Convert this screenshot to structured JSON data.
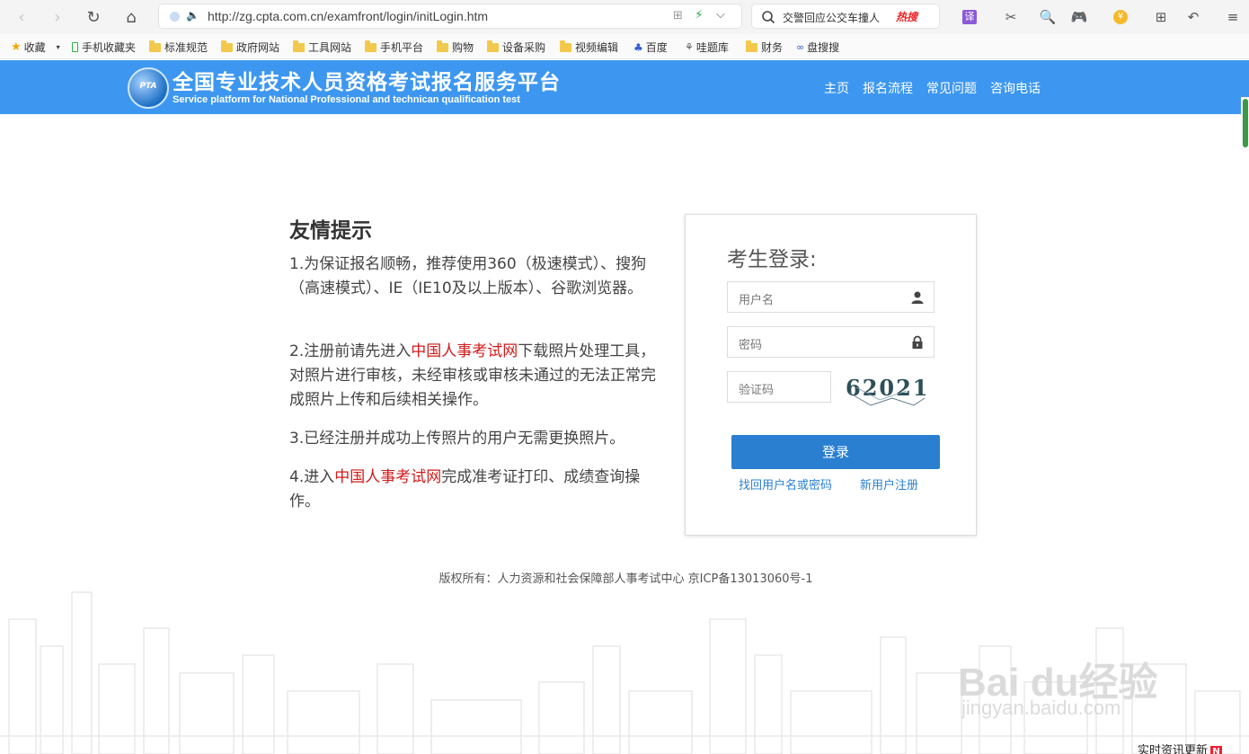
{
  "browser": {
    "url": "http://zg.cpta.com.cn/examfront/login/initLogin.htm",
    "search_text": "交警回应公交车撞人",
    "search_hot": "热搜"
  },
  "bookmarks": [
    "收藏",
    "手机收藏夹",
    "标准规范",
    "政府网站",
    "工具网站",
    "手机平台",
    "购物",
    "设备采购",
    "视频编辑",
    "百度",
    "哇题库",
    "财务",
    "盘搜搜"
  ],
  "site": {
    "logo_text": "PTA",
    "title": "全国专业技术人员资格考试报名服务平台",
    "subtitle": "Service platform for National Professional and technican qualification test",
    "nav": [
      "主页",
      "报名流程",
      "常见问题",
      "咨询电话"
    ]
  },
  "tips": {
    "title": "友情提示",
    "items": [
      {
        "text": "1.为保证报名顺畅，推荐使用360（极速模式）、搜狗（高速模式）、IE（IE10及以上版本）、谷歌浏览器。"
      },
      {
        "pre": "2.注册前请先进入",
        "link": "中国人事考试网",
        "post": "下载照片处理工具，对照片进行审核，未经审核或审核未通过的无法正常完成照片上传和后续相关操作。"
      },
      {
        "text": "3.已经注册并成功上传照片的用户无需更换照片。"
      },
      {
        "pre": "4.进入",
        "link": "中国人事考试网",
        "post": "完成准考证打印、成绩查询操作。"
      }
    ]
  },
  "login": {
    "title": "考生登录:",
    "username_placeholder": "用户名",
    "password_placeholder": "密码",
    "captcha_placeholder": "验证码",
    "captcha_value": "62021",
    "login_button": "登录",
    "forgot_link": "找回用户名或密码",
    "register_link": "新用户注册"
  },
  "footer": {
    "copyright": "版权所有：人力资源和社会保障部人事考试中心 京ICP备13013060号-1"
  },
  "watermark": {
    "brand": "Bai du经验",
    "domain": "jingyan.baidu.com"
  },
  "news_corner": {
    "label": "实时资讯更新",
    "badge": "N"
  }
}
